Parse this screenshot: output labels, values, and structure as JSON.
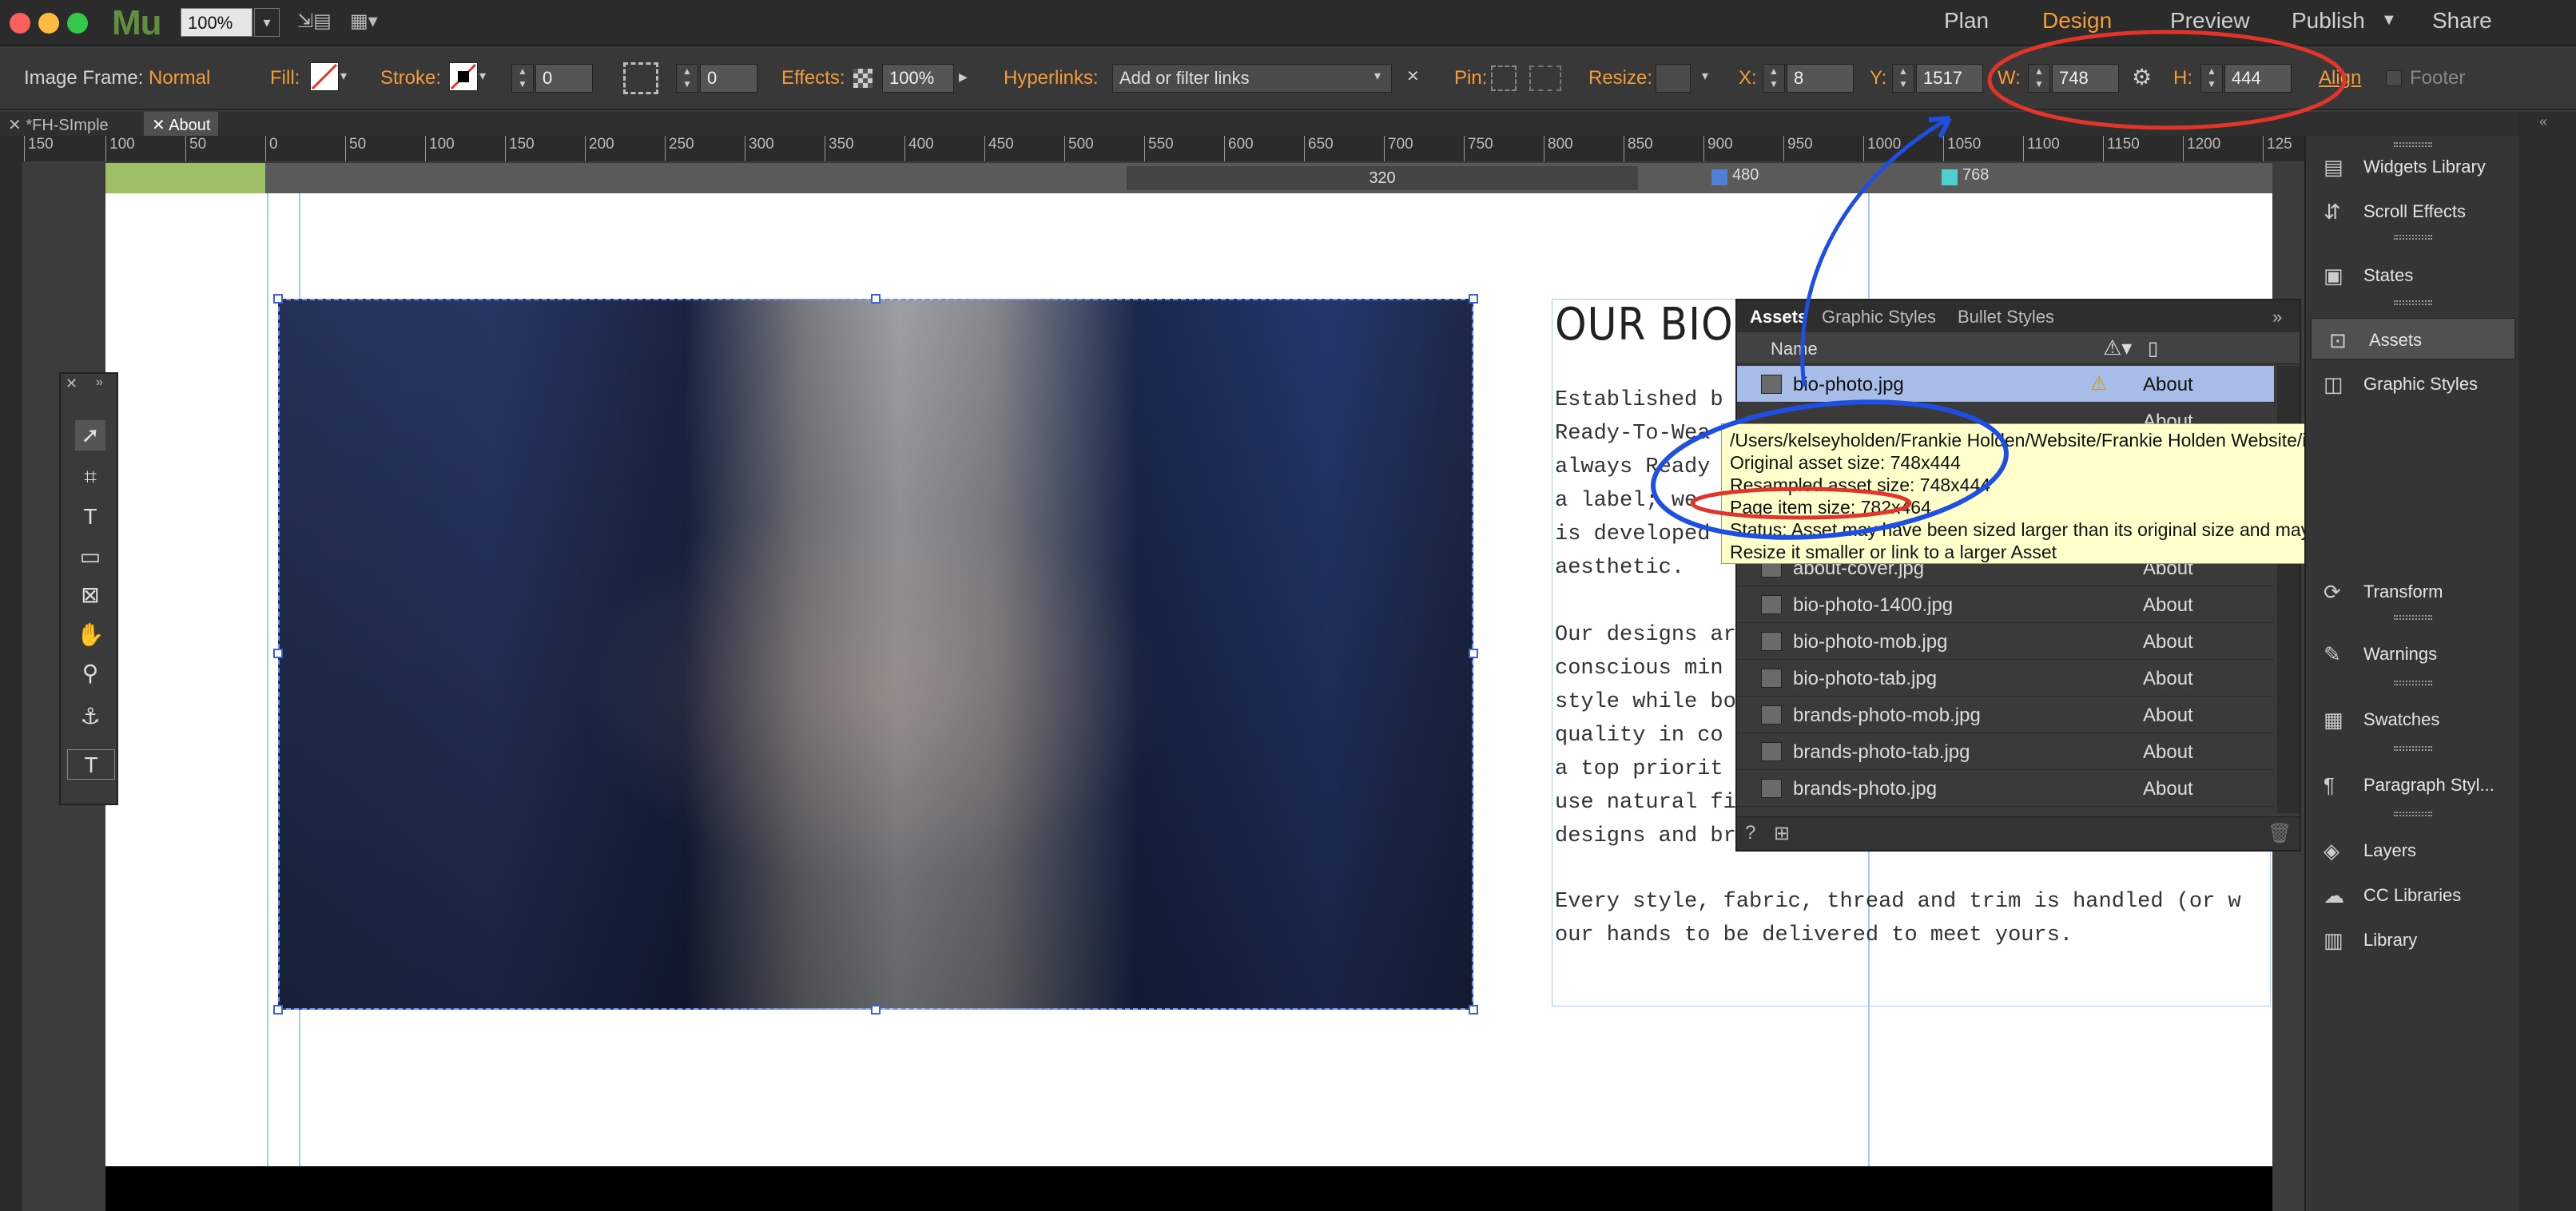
{
  "app": {
    "logo": "Mu",
    "zoom": "100%",
    "nav": [
      "Plan",
      "Design",
      "Preview",
      "Publish",
      "Share"
    ]
  },
  "controlbar": {
    "image_frame_label": "Image Frame:",
    "image_frame_value": "Normal",
    "fill_label": "Fill:",
    "stroke_label": "Stroke:",
    "stroke_value": "0",
    "corner_value": "0",
    "effects_label": "Effects:",
    "effects_value": "100%",
    "hyperlinks_label": "Hyperlinks:",
    "hyperlinks_placeholder": "Add or filter links",
    "pin_label": "Pin:",
    "resize_label": "Resize:",
    "x_label": "X:",
    "x_value": "8",
    "y_label": "Y:",
    "y_value": "1517",
    "w_label": "W:",
    "w_value": "748",
    "h_label": "H:",
    "h_value": "444",
    "align_label": "Align",
    "footer_label": "Footer"
  },
  "doc_tabs": [
    "*FH-SImple",
    "About"
  ],
  "ruler": [
    "150",
    "100",
    "50",
    "0",
    "50",
    "100",
    "150",
    "200",
    "250",
    "300",
    "350",
    "400",
    "450",
    "500",
    "550",
    "600",
    "650",
    "700",
    "750",
    "800",
    "850",
    "900",
    "950",
    "1000",
    "1050",
    "1100",
    "1150",
    "1200",
    "125"
  ],
  "breakpoints": {
    "range_label": "320",
    "bp1": "480",
    "bp2": "768",
    "bp1_color": "#4f7fd6",
    "bp2_color": "#4fd0c8"
  },
  "page": {
    "bio_heading": "OUR BIO:",
    "bio_lines": [
      "Established b",
      "Ready-To-Wea",
      "always Ready",
      "a label; we",
      "is developed",
      "aesthetic.",
      "",
      "Our designs ar",
      "conscious min",
      "style while bo",
      "quality in co",
      "a top priorit",
      "use natural fi",
      "designs and br",
      "",
      "Every style, fabric, thread and trim is handled (or w",
      "our hands to be delivered to meet yours."
    ]
  },
  "assets_panel": {
    "tabs": [
      "Assets",
      "Graphic Styles",
      "Bullet Styles"
    ],
    "col_name": "Name",
    "rows": [
      {
        "name": "bio-photo.jpg",
        "page": "About"
      },
      {
        "name": "about-cover.jpg",
        "page": "About"
      },
      {
        "name": "bio-photo-1400.jpg",
        "page": "About"
      },
      {
        "name": "bio-photo-mob.jpg",
        "page": "About"
      },
      {
        "name": "bio-photo-tab.jpg",
        "page": "About"
      },
      {
        "name": "brands-photo-mob.jpg",
        "page": "About"
      },
      {
        "name": "brands-photo-tab.jpg",
        "page": "About"
      },
      {
        "name": "brands-photo.jpg",
        "page": "About"
      }
    ],
    "hidden_row_page": "About"
  },
  "tooltip": {
    "path": "/Users/kelseyholden/Frankie Holden/Website/Frankie Holden Website/images/About/bio-photo.jpg",
    "original": "Original asset size: 748x444",
    "resampled": "Resampled asset size: 748x444",
    "page_item": "Page item size: 782x464",
    "status": "Status: Asset may have been sized larger than its original size and may look pixelated",
    "resize": "Resize it smaller or link to a larger Asset"
  },
  "right_panel": [
    {
      "label": "Widgets Library",
      "icon": "widgets-icon"
    },
    {
      "label": "Scroll Effects",
      "icon": "scroll-effects-icon"
    },
    {
      "label": "States",
      "icon": "states-icon"
    },
    {
      "label": "Assets",
      "icon": "assets-icon"
    },
    {
      "label": "Graphic Styles",
      "icon": "graphic-styles-icon"
    },
    {
      "label": "Transform",
      "icon": "transform-icon"
    },
    {
      "label": "Warnings",
      "icon": "warnings-icon"
    },
    {
      "label": "Swatches",
      "icon": "swatches-icon"
    },
    {
      "label": "Paragraph Styl...",
      "icon": "paragraph-styles-icon"
    },
    {
      "label": "Layers",
      "icon": "layers-icon"
    },
    {
      "label": "CC Libraries",
      "icon": "cc-libraries-icon"
    },
    {
      "label": "Library",
      "icon": "library-icon"
    }
  ],
  "colors": {
    "accent": "#f39c3a",
    "annotation_red": "#e0352b",
    "annotation_blue": "#1f4fe0"
  }
}
